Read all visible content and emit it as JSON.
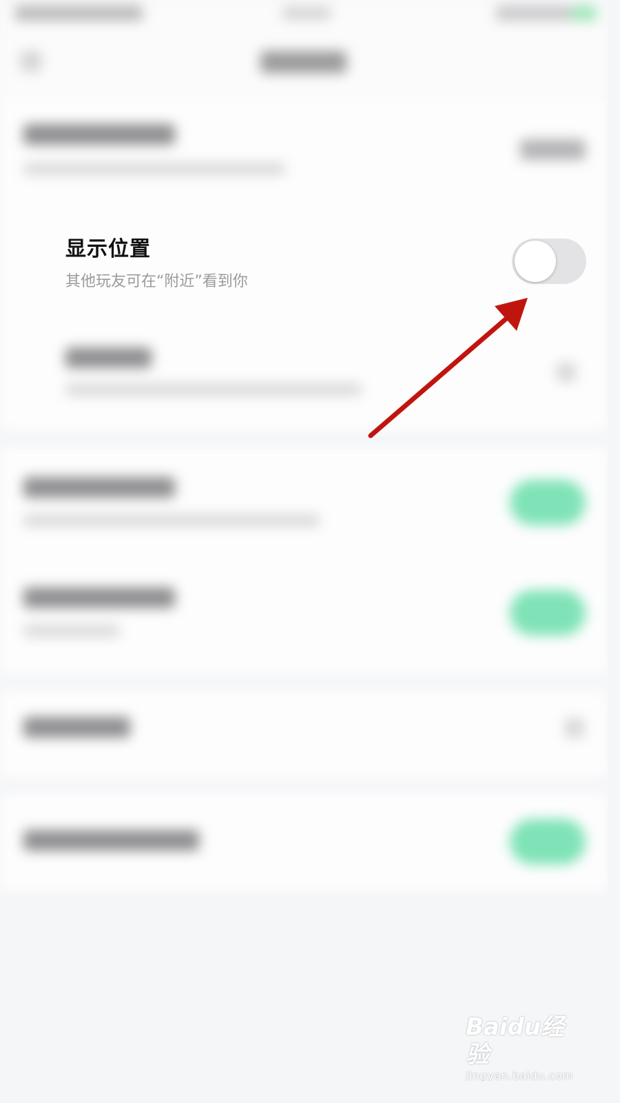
{
  "setting": {
    "title": "显示位置",
    "subtitle": "其他玩友可在“附近”看到你",
    "toggle_state": "off"
  },
  "colors": {
    "annotation_arrow": "#c0150f",
    "toggle_on": "#7fe3b7",
    "toggle_off": "#e3e3e5"
  },
  "watermark": {
    "logo": "Baidu经验",
    "url": "jingyan.baidu.com"
  }
}
